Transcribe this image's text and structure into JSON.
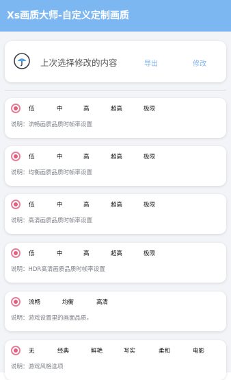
{
  "app": {
    "title": "Xs画质大师-自定义定制画质"
  },
  "last_selection": {
    "text": "上次选择修改的内容",
    "export_label": "导出",
    "modify_label": "修改"
  },
  "settings": [
    {
      "options": [
        "低",
        "中",
        "高",
        "超高",
        "极限"
      ],
      "description": "说明：流畅画质品质时帧率设置"
    },
    {
      "options": [
        "低",
        "中",
        "高",
        "超高",
        "极限"
      ],
      "description": "说明：均衡画质品质时帧率设置"
    },
    {
      "options": [
        "低",
        "中",
        "高",
        "超高",
        "极限"
      ],
      "description": "说明：高清画质品质时帧率设置"
    },
    {
      "options": [
        "低",
        "中",
        "高",
        "超高",
        "极限"
      ],
      "description": "说明：HDR高清画质品质时帧率设置"
    },
    {
      "options": [
        "流畅",
        "均衡",
        "高清"
      ],
      "description": "说明：游戏设置里的画面品质。"
    },
    {
      "options": [
        "无",
        "经典",
        "鲜艳",
        "写实",
        "柔和",
        "电影"
      ],
      "description": "说明：游戏风格选项"
    }
  ],
  "colors": {
    "accent": "#7db7f2",
    "radio": "#e0607e",
    "link": "#7cb3ee"
  },
  "icons": {
    "last_selection": "umbrella-icon",
    "radio": "radio-selected-icon"
  }
}
